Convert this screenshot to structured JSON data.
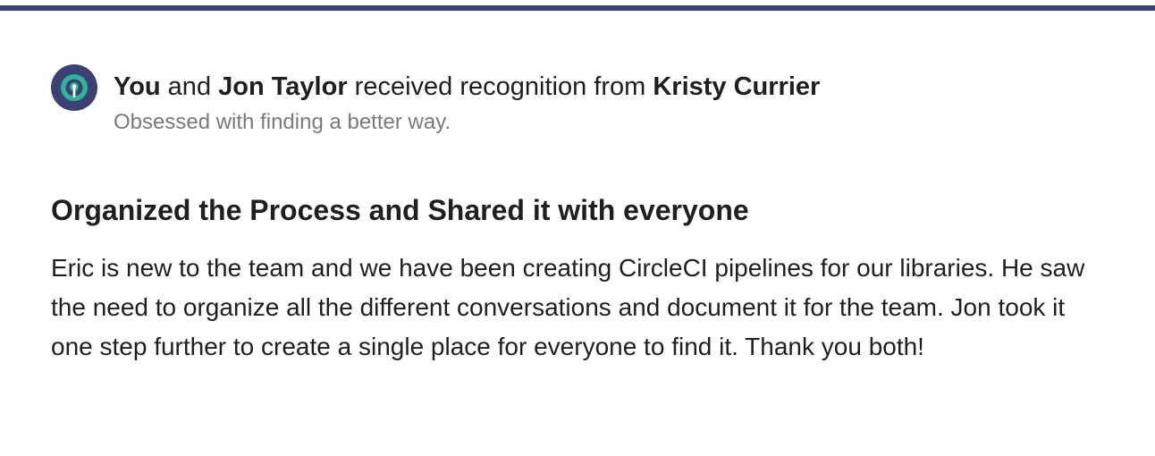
{
  "recognition": {
    "recipient_you": "You",
    "and_text": " and ",
    "recipient_other": "Jon Taylor",
    "received_text": " received recognition from ",
    "giver": "Kristy Currier",
    "value_tag": "Obsessed with finding a better way."
  },
  "post": {
    "title": "Organized the Process and Shared it with everyone",
    "message": "Eric is new to the team and we have been creating CircleCI pipelines for our libraries. He saw the need to organize all the different conversations and document it for the team. Jon took it one step further to create a single place for everyone to find it. Thank you both!"
  },
  "colors": {
    "accent_bar": "#3b4173",
    "avatar_background": "#3b4173",
    "avatar_icon": "#2fb39a",
    "subtle_text": "#7a7a7a",
    "body_text": "#1f1f1f"
  },
  "icons": {
    "avatar": "recognition-badge-icon"
  }
}
